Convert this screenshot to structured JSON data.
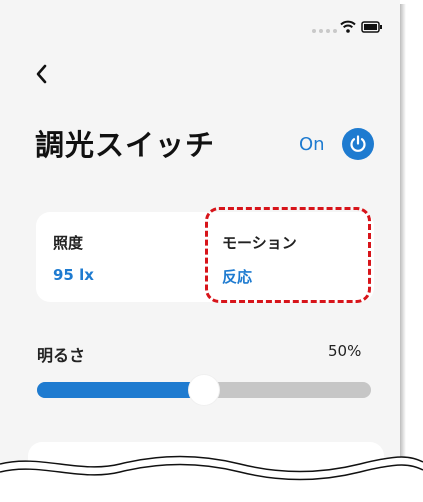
{
  "header": {
    "title": "調光スイッチ",
    "power_state_label": "On"
  },
  "icons": {
    "back": "chevron-left-icon",
    "power": "power-icon",
    "wifi": "wifi-icon",
    "battery": "battery-icon"
  },
  "sensors": [
    {
      "label": "照度",
      "value": "95 lx"
    },
    {
      "label": "モーション",
      "value": "反応"
    }
  ],
  "brightness": {
    "label": "明るさ",
    "value_text": "50%",
    "level": 0.5
  },
  "colors": {
    "accent": "#1e7bd0",
    "highlight": "#d7141a",
    "track_inactive": "#c6c6c6",
    "background": "#f5f5f5"
  }
}
